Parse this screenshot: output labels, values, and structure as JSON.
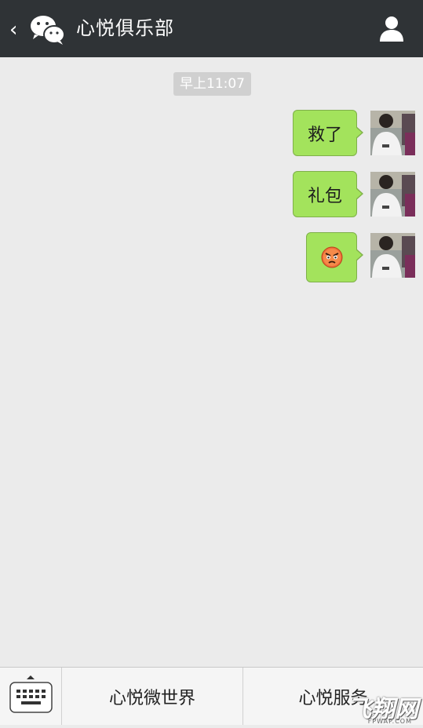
{
  "header": {
    "title": "心悦俱乐部",
    "back_glyph": "‹",
    "bg_color": "#2f3336"
  },
  "chat": {
    "timestamp": "早上11:07",
    "messages": [
      {
        "text": "救了",
        "from": "me"
      },
      {
        "text": "礼包",
        "from": "me"
      },
      {
        "emoji": "angry-face",
        "from": "me"
      }
    ],
    "bubble_color": "#a3e35c"
  },
  "bottom_menu": {
    "items": [
      "心悦微世界",
      "心悦服务"
    ]
  },
  "watermark": {
    "text": "飞翔网",
    "sub": "FPWAP.COM"
  }
}
